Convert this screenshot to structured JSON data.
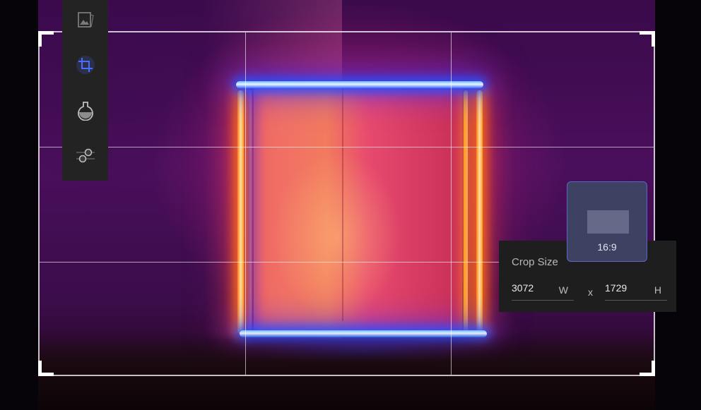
{
  "toolbar": {
    "tools": [
      {
        "name": "image-icon",
        "active": false
      },
      {
        "name": "crop-icon",
        "active": true
      },
      {
        "name": "filter-icon",
        "active": false
      },
      {
        "name": "adjust-icon",
        "active": false
      }
    ]
  },
  "crop_size": {
    "title": "Crop Size",
    "width_value": "3072",
    "width_unit": "W",
    "separator": "x",
    "height_value": "1729",
    "height_unit": "H"
  },
  "aspect_ratio": {
    "label": "16:9"
  },
  "colors": {
    "accent": "#3b5bd8",
    "panel_bg": "#1e1e1e",
    "toolbar_bg": "#232323",
    "aspect_bg": "#3e4262"
  }
}
